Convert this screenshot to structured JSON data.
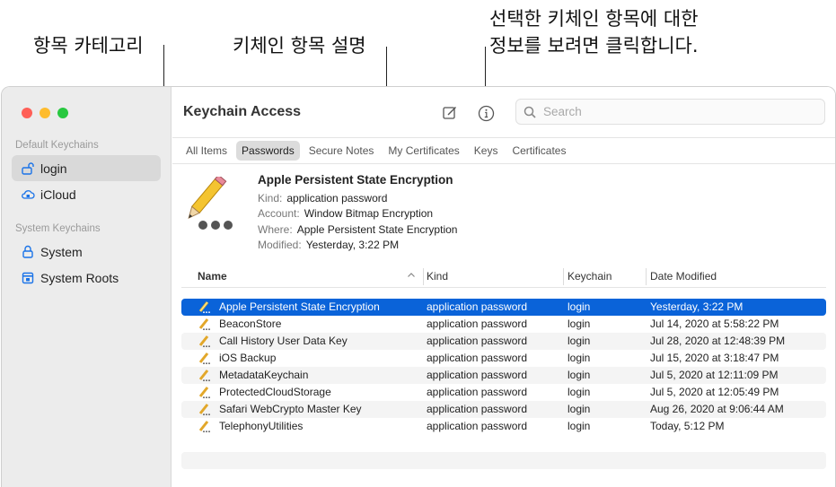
{
  "annotations": {
    "category": "항목 카테고리",
    "description": "키체인 항목 설명",
    "info_line1": "선택한 키체인 항목에 대한",
    "info_line2": "정보를 보려면 클릭합니다."
  },
  "sidebar": {
    "default_header": "Default Keychains",
    "system_header": "System Keychains",
    "items": [
      {
        "label": "login",
        "icon": "lock-open-icon"
      },
      {
        "label": "iCloud",
        "icon": "icloud-icon"
      },
      {
        "label": "System",
        "icon": "lock-icon"
      },
      {
        "label": "System Roots",
        "icon": "cabinet-icon"
      }
    ]
  },
  "toolbar": {
    "title": "Keychain Access",
    "search_placeholder": "Search"
  },
  "tabs": [
    "All Items",
    "Passwords",
    "Secure Notes",
    "My Certificates",
    "Keys",
    "Certificates"
  ],
  "detail": {
    "name": "Apple Persistent State Encryption",
    "kind_label": "Kind:",
    "kind": "application password",
    "account_label": "Account:",
    "account": "Window Bitmap Encryption",
    "where_label": "Where:",
    "where": "Apple Persistent State Encryption",
    "modified_label": "Modified:",
    "modified": "Yesterday, 3:22 PM"
  },
  "table": {
    "columns": [
      "Name",
      "Kind",
      "Keychain",
      "Date Modified"
    ],
    "rows": [
      [
        "Apple Persistent State Encryption",
        "application password",
        "login",
        "Yesterday, 3:22 PM"
      ],
      [
        "BeaconStore",
        "application password",
        "login",
        "Jul 14, 2020 at 5:58:22 PM"
      ],
      [
        "Call History User Data Key",
        "application password",
        "login",
        "Jul 28, 2020 at 12:48:39 PM"
      ],
      [
        "iOS Backup",
        "application password",
        "login",
        "Jul 15, 2020 at 3:18:47 PM"
      ],
      [
        "MetadataKeychain",
        "application password",
        "login",
        "Jul 5, 2020 at 12:11:09 PM"
      ],
      [
        "ProtectedCloudStorage",
        "application password",
        "login",
        "Jul 5, 2020 at 12:05:49 PM"
      ],
      [
        "Safari WebCrypto Master Key",
        "application password",
        "login",
        "Aug 26, 2020 at 9:06:44 AM"
      ],
      [
        "TelephonyUtilities",
        "application password",
        "login",
        "Today, 5:12 PM"
      ]
    ]
  },
  "colors": {
    "selection": "#0a63d9",
    "close": "#ff5f57",
    "minimize": "#febc2e",
    "zoom": "#28c840",
    "accent": "#1a73e8"
  }
}
